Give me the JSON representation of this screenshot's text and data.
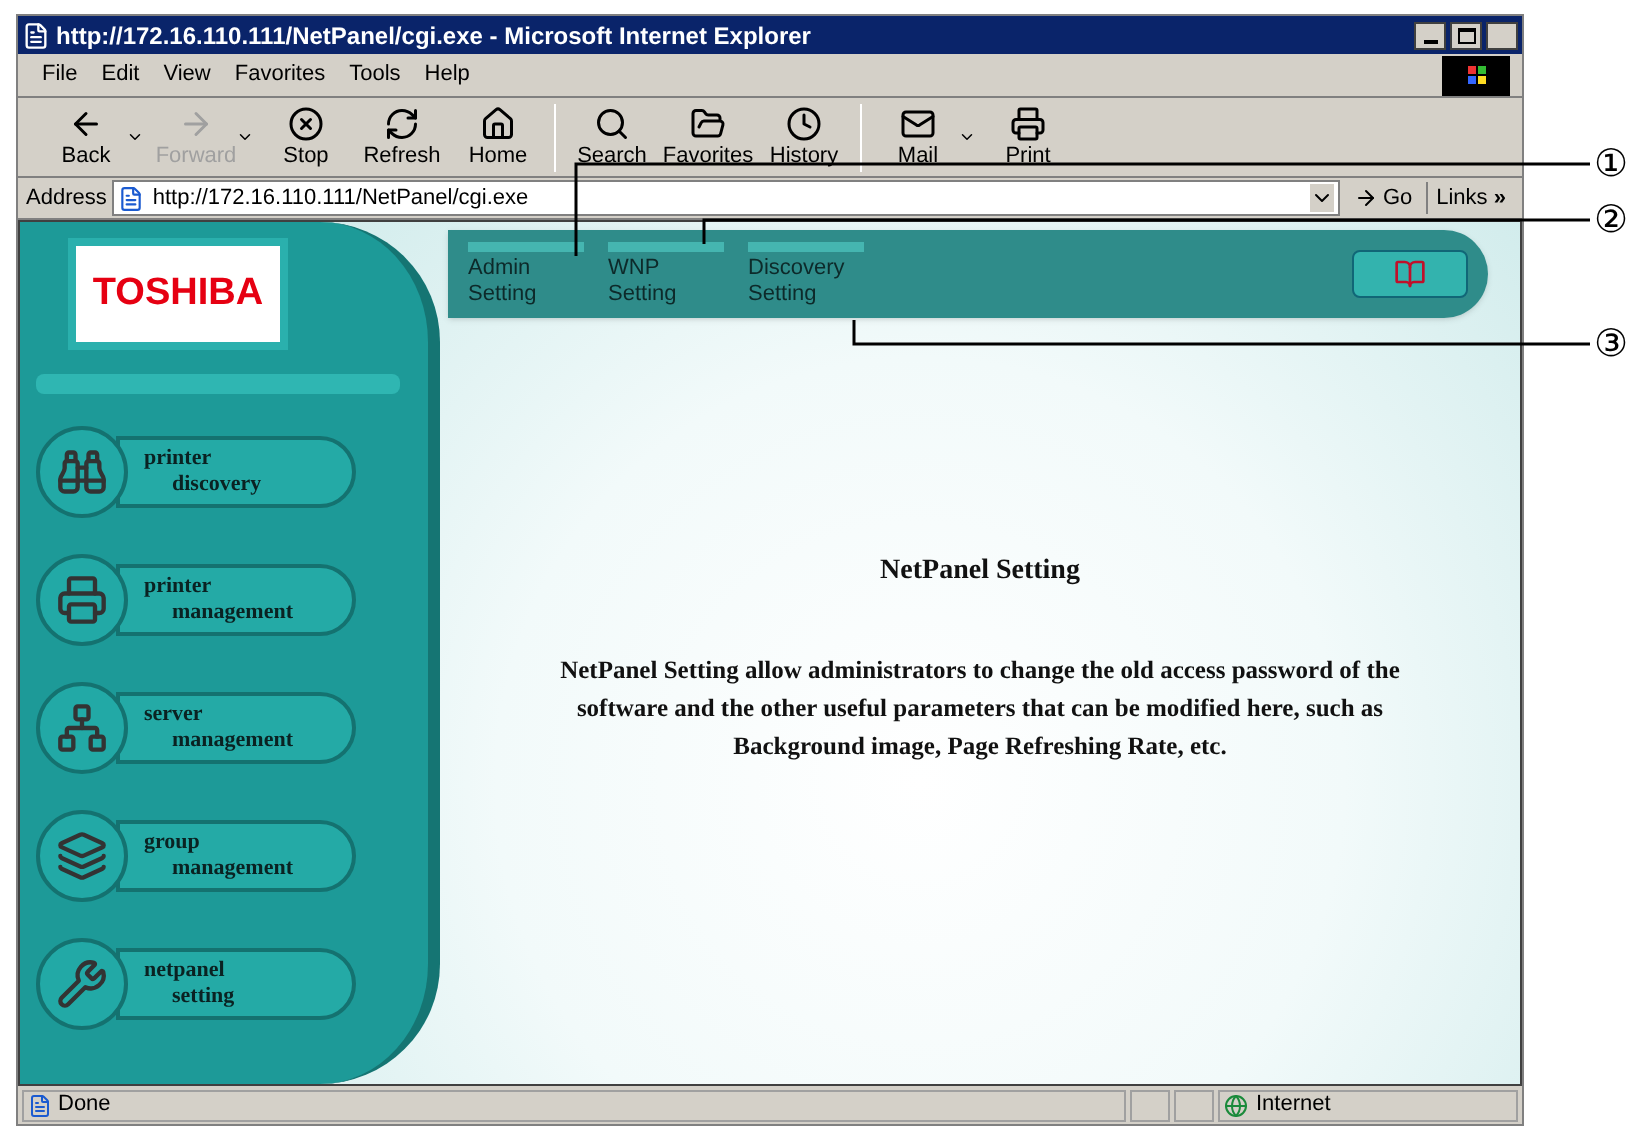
{
  "window": {
    "title": "http://172.16.110.111/NetPanel/cgi.exe - Microsoft Internet Explorer"
  },
  "menu": [
    "File",
    "Edit",
    "View",
    "Favorites",
    "Tools",
    "Help"
  ],
  "toolbar_groups": [
    [
      {
        "kind": "back",
        "label": "Back",
        "disabled": false,
        "dropdown": true
      },
      {
        "kind": "forward",
        "label": "Forward",
        "disabled": true,
        "dropdown": true
      },
      {
        "kind": "stop",
        "label": "Stop",
        "disabled": false,
        "dropdown": false
      },
      {
        "kind": "refresh",
        "label": "Refresh",
        "disabled": false,
        "dropdown": false
      },
      {
        "kind": "home",
        "label": "Home",
        "disabled": false,
        "dropdown": false
      }
    ],
    [
      {
        "kind": "search",
        "label": "Search",
        "disabled": false,
        "dropdown": false
      },
      {
        "kind": "favorites",
        "label": "Favorites",
        "disabled": false,
        "dropdown": false
      },
      {
        "kind": "history",
        "label": "History",
        "disabled": false,
        "dropdown": false
      }
    ],
    [
      {
        "kind": "mail",
        "label": "Mail",
        "disabled": false,
        "dropdown": true
      },
      {
        "kind": "print",
        "label": "Print",
        "disabled": false,
        "dropdown": false
      }
    ]
  ],
  "address": {
    "label": "Address",
    "value": "http://172.16.110.111/NetPanel/cgi.exe"
  },
  "go_button": "Go",
  "links_button": "Links",
  "links_chevron": "»",
  "logo": "TOSHIBA",
  "top_nav": [
    {
      "lines": [
        "Admin",
        "Setting"
      ]
    },
    {
      "lines": [
        "WNP",
        "Setting"
      ]
    },
    {
      "lines": [
        "Discovery",
        "Setting"
      ]
    }
  ],
  "sidebar": {
    "items": [
      {
        "kind": "binoculars",
        "lines": [
          "printer",
          "discovery"
        ]
      },
      {
        "kind": "printer",
        "lines": [
          "printer",
          "management"
        ]
      },
      {
        "kind": "network",
        "lines": [
          "server",
          "management"
        ]
      },
      {
        "kind": "group",
        "lines": [
          "group",
          "management"
        ]
      },
      {
        "kind": "wrench",
        "lines": [
          "netpanel",
          "setting"
        ]
      }
    ]
  },
  "content": {
    "heading": "NetPanel Setting",
    "body": "NetPanel Setting allow administrators to change the old access password of the software and the other useful parameters that can be modified here, such as Background image, Page Refreshing Rate, etc."
  },
  "status_bar": {
    "text": "Done",
    "zone": "Internet"
  },
  "callouts": [
    "①",
    "②",
    "③"
  ]
}
